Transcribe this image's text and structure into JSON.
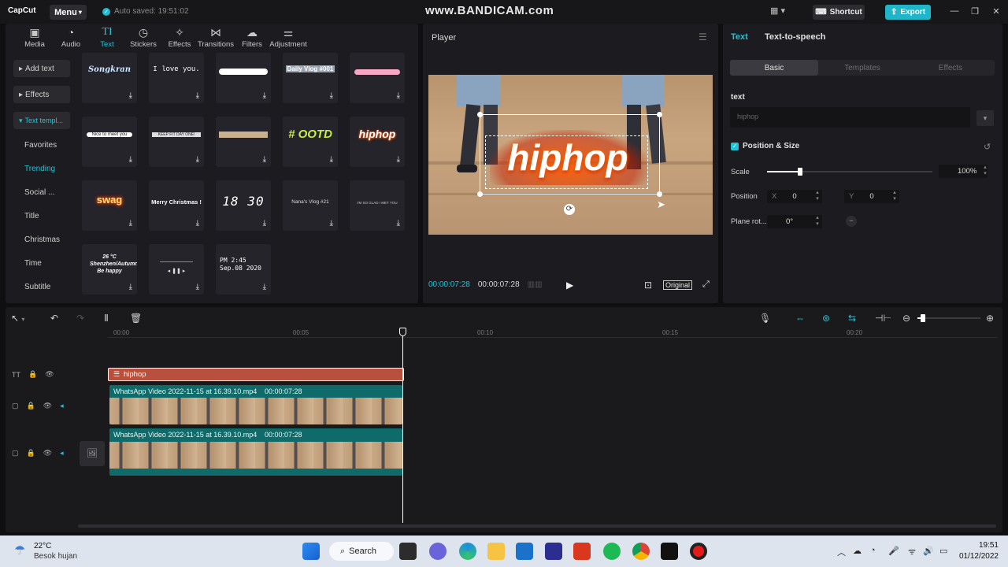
{
  "titlebar": {
    "logo": "CapCut",
    "menu_label": "Menu",
    "autosave": "Auto saved: 19:51:02",
    "watermark": "www.BANDICAM.com",
    "shortcut_label": "Shortcut",
    "export_label": "Export"
  },
  "toolbar": {
    "items": [
      {
        "label": "Media",
        "icon": "film-icon"
      },
      {
        "label": "Audio",
        "icon": "audio-icon"
      },
      {
        "label": "Text",
        "icon": "text-icon"
      },
      {
        "label": "Stickers",
        "icon": "sticker-icon"
      },
      {
        "label": "Effects",
        "icon": "sparkle-icon"
      },
      {
        "label": "Transitions",
        "icon": "transition-icon"
      },
      {
        "label": "Filters",
        "icon": "filter-icon"
      },
      {
        "label": "Adjustment",
        "icon": "sliders-icon"
      }
    ]
  },
  "sidenav": {
    "add_text": "Add text",
    "effects": "Effects",
    "text_templates": "Text templ...",
    "categories": [
      "Favorites",
      "Trending",
      "Social ...",
      "Title",
      "Christmas",
      "Time",
      "Subtitle"
    ]
  },
  "templates": [
    "Songkran",
    "I love you.",
    "",
    "Daily Vlog #001",
    "",
    "Nice to meet you",
    "KEEP FIT DAY ONE!",
    "",
    "# OOTD",
    "hiphop",
    "swag",
    "Merry Christmas !",
    "18 30",
    "Nana's Vlog #21",
    "I'M SO GLAD I MET YOU",
    "26 °C Shenzhen/Autumn Be happy",
    "",
    "PM 2:45 Sep.08 2020"
  ],
  "player": {
    "title": "Player",
    "overlay_text": "hiphop",
    "time_current": "00:00:07:28",
    "time_total": "00:00:07:28",
    "original_label": "Original"
  },
  "inspector": {
    "tab_text": "Text",
    "tab_tts": "Text-to-speech",
    "seg_basic": "Basic",
    "seg_templates": "Templates",
    "seg_effects": "Effects",
    "text_label": "text",
    "text_value": "hiphop",
    "pos_size_label": "Position & Size",
    "scale_label": "Scale",
    "scale_value": "100%",
    "scale_fraction": 0.2,
    "position_label": "Position",
    "x_label": "X",
    "x_value": "0",
    "y_label": "Y",
    "y_value": "0",
    "rotation_label": "Plane rot...",
    "rotation_value": "0°"
  },
  "timeline": {
    "ruler": [
      "00:00",
      "00:05",
      "00:10",
      "00:15",
      "00:20"
    ],
    "text_clip": "hiphop",
    "video_clip_1": "WhatsApp Video 2022-11-15 at 16.39.10.mp4",
    "video_clip_1_duration": "00:00:07:28",
    "video_clip_2": "WhatsApp Video 2022-11-15 at 16.39.10.mp4",
    "video_clip_2_duration": "00:00:07:28"
  },
  "taskbar": {
    "weather_temp": "22°C",
    "weather_desc": "Besok hujan",
    "search_label": "Search",
    "time": "19:51",
    "date": "01/12/2022"
  },
  "colors": {
    "accent": "#22c2d4",
    "text_clip": "#b7503c",
    "video_track": "#0f6a6a"
  }
}
